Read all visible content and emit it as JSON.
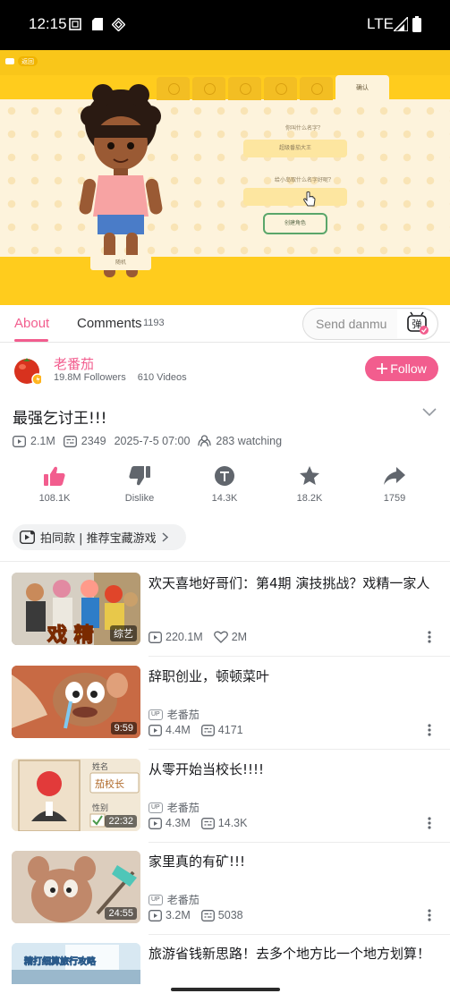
{
  "status_bar": {
    "time": "12:15",
    "network": "LTE"
  },
  "player": {
    "game_tab_confirm": "确认",
    "question_name": "你叫什么名字？",
    "name_value": "超级番茄大王",
    "question_pet": "给小岛取什么名字好呢？",
    "create_button": "创建角色",
    "random_button": "随机",
    "mini_label": "返回"
  },
  "tabs": {
    "about": "About",
    "comments": "Comments",
    "comments_count": "1193",
    "danmu_placeholder": "Send danmu",
    "danmu_icon_char": "弹"
  },
  "uploader": {
    "name": "老番茄",
    "followers": "19.8M Followers",
    "videos": "610 Videos",
    "follow_label": "Follow"
  },
  "video": {
    "title": "最强乞讨王!!!",
    "plays": "2.1M",
    "danmaku": "2349",
    "date": "2025-7-5 07:00",
    "watching": "283 watching"
  },
  "actions": {
    "like": "108.1K",
    "dislike": "Dislike",
    "coin": "14.3K",
    "favorite": "18.2K",
    "share": "1759"
  },
  "chip": {
    "label": "拍同款 | 推荐宝藏游戏"
  },
  "related": [
    {
      "title": "欢天喜地好哥们：第4期 演技挑战？戏精一家人",
      "badge": "综艺",
      "up": "",
      "stats": [
        "220.1M",
        "2M"
      ],
      "thumb_text": "戏 精"
    },
    {
      "title": "辞职创业，顿顿菜叶",
      "badge": "9:59",
      "up": "老番茄",
      "stats": [
        "4.4M",
        "4171"
      ]
    },
    {
      "title": "从零开始当校长!!!!",
      "badge": "22:32",
      "up": "老番茄",
      "stats": [
        "4.3M",
        "14.3K"
      ],
      "thumb_label_1": "姓名",
      "thumb_label_2": "茄校长",
      "thumb_label_3": "性别"
    },
    {
      "title": "家里真的有矿!!!",
      "badge": "24:55",
      "up": "老番茄",
      "stats": [
        "3.2M",
        "5038"
      ]
    },
    {
      "title": "旅游省钱新思路！去多个地方比一个地方划算！",
      "badge": "",
      "up": "",
      "stats": [],
      "thumb_text": "精打细算旅行攻略"
    }
  ],
  "colors": {
    "accent": "#f25d8e",
    "text": "#18191c",
    "muted": "#61666d"
  }
}
